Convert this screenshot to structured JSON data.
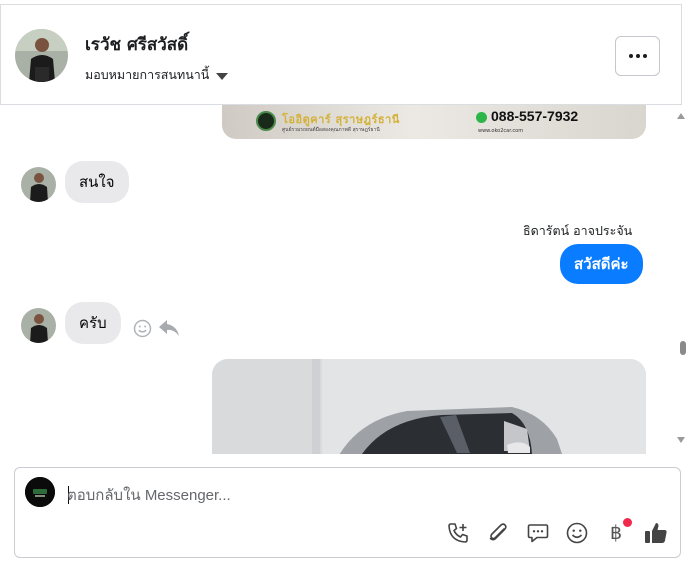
{
  "header": {
    "contact_name": "เรวัช ศรีสวัสดิ์",
    "assign_label": "มอบหมายการสนทนานี้"
  },
  "thread": {
    "banner": {
      "brand": "โออิตูคาร์ สุราษฎร์ธานี",
      "sub": "ศูนย์รวมรถยนต์มือสองคุณภาพดี สุราษฎร์ธานี",
      "phone": "088-557-7932",
      "web": "www.oko2car.com"
    },
    "messages": [
      {
        "direction": "in",
        "text": "สนใจ"
      },
      {
        "direction": "out",
        "sender": "ธิดารัตน์ อาจประจัน",
        "text": "สวัสดีค่ะ"
      },
      {
        "direction": "in",
        "text": "ครับ"
      }
    ]
  },
  "composer": {
    "placeholder": "ตอบกลับใน Messenger..."
  },
  "icons": {
    "more": "more-horizontal-icon",
    "react": "smiley-icon",
    "reply": "reply-icon",
    "call": "phone-add-icon",
    "attach": "paperclip-icon",
    "saved_reply": "chat-bubble-icon",
    "emoji": "smiley-icon",
    "payment": "baht-icon",
    "like": "thumbs-up-icon"
  },
  "colors": {
    "outgoing_bubble": "#0a7cff",
    "incoming_bubble": "#e9e9eb",
    "notification": "#f02849"
  }
}
